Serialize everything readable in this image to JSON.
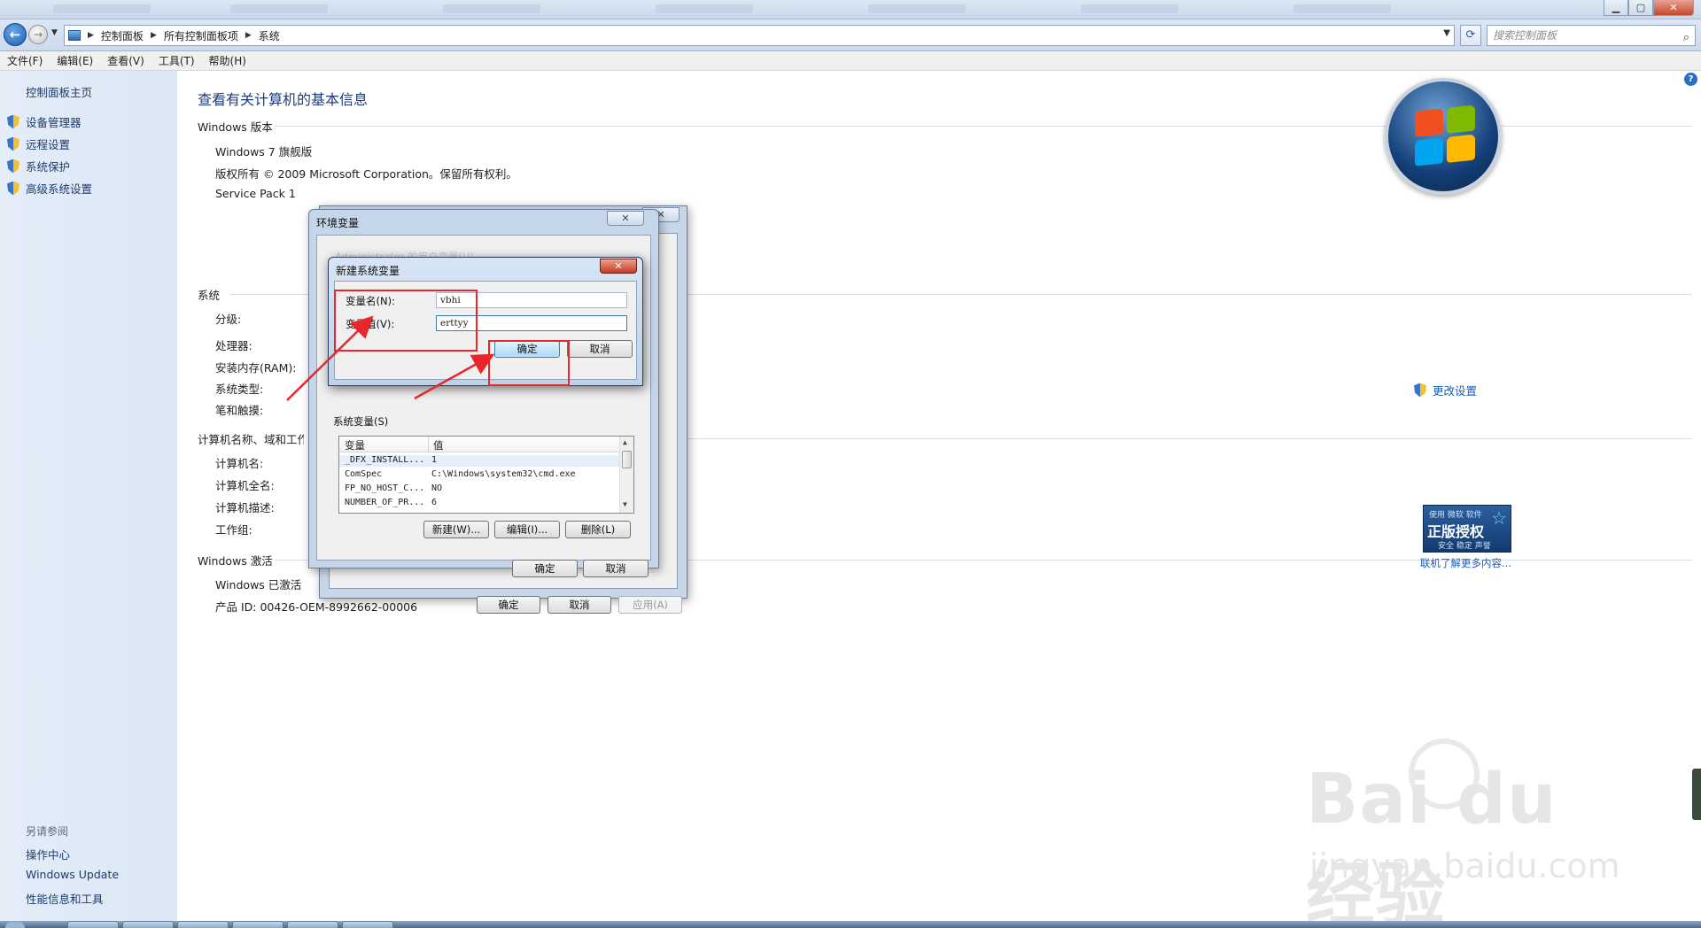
{
  "titlebar": {
    "buttons": {
      "minimize": "▁",
      "maximize": "▢",
      "close": "✕"
    }
  },
  "address": {
    "back_icon": "back-arrow-icon",
    "forward_icon": "forward-arrow-icon",
    "crumbs": [
      "控制面板",
      "所有控制面板项",
      "系统"
    ],
    "search_placeholder": "搜索控制面板"
  },
  "menu": [
    "文件(F)",
    "编辑(E)",
    "查看(V)",
    "工具(T)",
    "帮助(H)"
  ],
  "sidebar": {
    "home": "控制面板主页",
    "items": [
      {
        "label": "设备管理器",
        "icon": "shield-icon"
      },
      {
        "label": "远程设置",
        "icon": "shield-icon"
      },
      {
        "label": "系统保护",
        "icon": "shield-icon"
      },
      {
        "label": "高级系统设置",
        "icon": "shield-icon"
      }
    ],
    "see_also_title": "另请参阅",
    "see_also": [
      "操作中心",
      "Windows Update",
      "性能信息和工具"
    ]
  },
  "main": {
    "title": "查看有关计算机的基本信息",
    "edition": {
      "heading": "Windows 版本",
      "name": "Windows 7 旗舰版",
      "copyright": "版权所有 © 2009 Microsoft Corporation。保留所有权利。",
      "service_pack": "Service Pack 1"
    },
    "system": {
      "heading": "系统",
      "rows": [
        "分级:",
        "处理器:",
        "安装内存(RAM):",
        "系统类型:",
        "笔和触摸:"
      ]
    },
    "computer": {
      "heading": "计算机名称、域和工作组设置",
      "rows": [
        "计算机名:",
        "计算机全名:",
        "计算机描述:",
        "工作组:"
      ],
      "change_settings": "更改设置"
    },
    "activation": {
      "heading": "Windows 激活",
      "status": "Windows 已激活",
      "product_id": "产品 ID: 00426-OEM-8992662-00006"
    },
    "genuine": {
      "top": "使用 微软 软件",
      "middle": "正版授权",
      "bottom": "安全 稳定 声誉",
      "link": "联机了解更多内容..."
    }
  },
  "sysprops_dialog": {
    "ok": "确定",
    "cancel": "取消",
    "apply": "应用(A)"
  },
  "env_dialog": {
    "title": "环境变量",
    "user_vars_label": "Administrator 的用户变量(U)",
    "system_vars_label": "系统变量(S)",
    "columns": [
      "变量",
      "值"
    ],
    "rows": [
      {
        "name": "_DFX_INSTALL...",
        "value": "1"
      },
      {
        "name": "ComSpec",
        "value": "C:\\Windows\\system32\\cmd.exe"
      },
      {
        "name": "FP_NO_HOST_C...",
        "value": "NO"
      },
      {
        "name": "NUMBER_OF_PR...",
        "value": "6"
      }
    ],
    "new_btn": "新建(W)...",
    "edit_btn": "编辑(I)...",
    "delete_btn": "删除(L)",
    "ok": "确定",
    "cancel": "取消"
  },
  "new_var_dialog": {
    "title": "新建系统变量",
    "name_label": "变量名(N):",
    "name_value": "vbhi",
    "value_label": "变量值(V):",
    "value_value": "erttyy",
    "ok": "确定",
    "cancel": "取消"
  },
  "watermark": {
    "brand": "Bai du 经验",
    "url": "jingyan.baidu.com"
  },
  "colors": {
    "annotation_red": "#e8262b",
    "link_blue": "#1b5cb8",
    "title_blue": "#1e3d7a"
  }
}
